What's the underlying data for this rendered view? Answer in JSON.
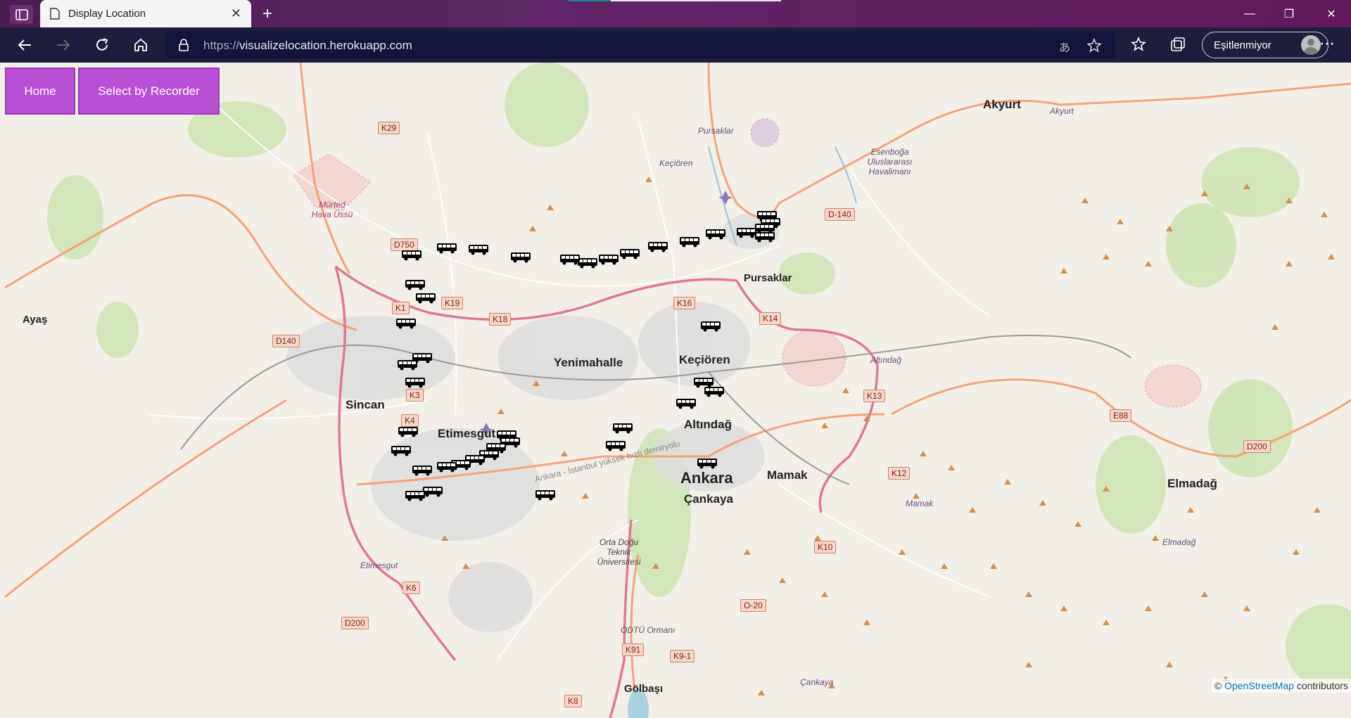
{
  "browser": {
    "tab_title": "Display Location",
    "url_protocol": "https://",
    "url_host": "visualizelocation.herokuapp.com",
    "profile_label": "Eşitlenmiyor"
  },
  "page": {
    "buttons": {
      "home": "Home",
      "select_by_recorder": "Select by Recorder"
    },
    "attribution_prefix": "©",
    "attribution_link": "OpenStreetMap",
    "attribution_suffix": "contributors"
  },
  "map_labels": {
    "akyurt": "Akyurt",
    "akyurt_road": "Akyurt",
    "pursaklar": "Pursaklar",
    "kecioren_area": "Keçiören",
    "esenboga": "Esenboğa Uluslararası Havalimanı",
    "murted": "Mürted Hava Üssü",
    "ayas": "Ayaş",
    "pursaklar_city": "Pursaklar",
    "yenimahalle": "Yenimahalle",
    "kecioren": "Keçiören",
    "altindag_area": "Altındağ",
    "sincan": "Sincan",
    "etimesgut": "Etimesgut",
    "altindag": "Altındağ",
    "ankara": "Ankara",
    "mamak": "Mamak",
    "cankaya": "Çankaya",
    "elmadag": "Elmadağ",
    "elmadag_area": "Elmadağ",
    "mamak_area": "Mamak",
    "etimesgut_area": "Etimesgut",
    "odtu": "Orta Doğu Teknik Üniversitesi",
    "odtu_ormani": "ODTÜ Ormanı",
    "golbasi": "Gölbaşı",
    "cankaya_area": "Çankaya",
    "rail": "Ankara - İstanbul yüksek hızlı demiryolu"
  },
  "road_shields": [
    "K29",
    "D750",
    "D140",
    "D-140",
    "E88",
    "D200",
    "D200",
    "O-20",
    "K13",
    "K12",
    "K10",
    "K9-1",
    "K91",
    "K8",
    "K6",
    "K4",
    "K3",
    "K1",
    "K19",
    "K18",
    "K16",
    "K14"
  ]
}
